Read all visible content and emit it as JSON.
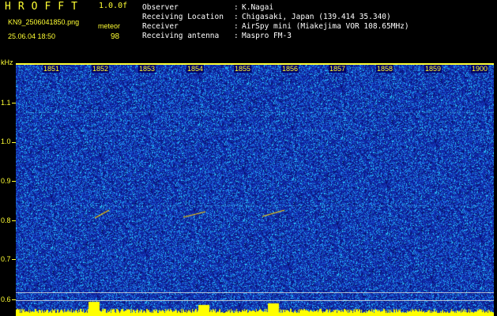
{
  "header": {
    "logo": "HROFFT",
    "version": "1.0.0f",
    "filename": "KN9_2506041850.png",
    "meteor_label": "meteor",
    "datetime": "25.06.04 18:50",
    "meteor_count": "98"
  },
  "info": [
    {
      "key": "Observer",
      "value": "K.Nagai"
    },
    {
      "key": "Receiving Location",
      "value": "Chigasaki, Japan (139.414 35.340)"
    },
    {
      "key": "Receiver",
      "value": "AirSpy mini (Miakejima VOR 108.65MHz)"
    },
    {
      "key": "Receiving antenna",
      "value": "Maspro FM-3"
    }
  ],
  "axis": {
    "y_unit": "kHz",
    "y_ticks": [
      "1.1",
      "1.0",
      "0.9",
      "0.8",
      "0.7",
      "0.6"
    ],
    "x_ticks": [
      "1851",
      "1852",
      "1853",
      "1854",
      "1855",
      "1856",
      "1857",
      "1858",
      "1859",
      "1900"
    ]
  },
  "colors": {
    "background": "#000000",
    "text_yellow": "#ffff33",
    "spectrum_base": "#0a1a8c",
    "noise_bright": "#39c8ff",
    "meteor_echo": "#ffd000"
  }
}
